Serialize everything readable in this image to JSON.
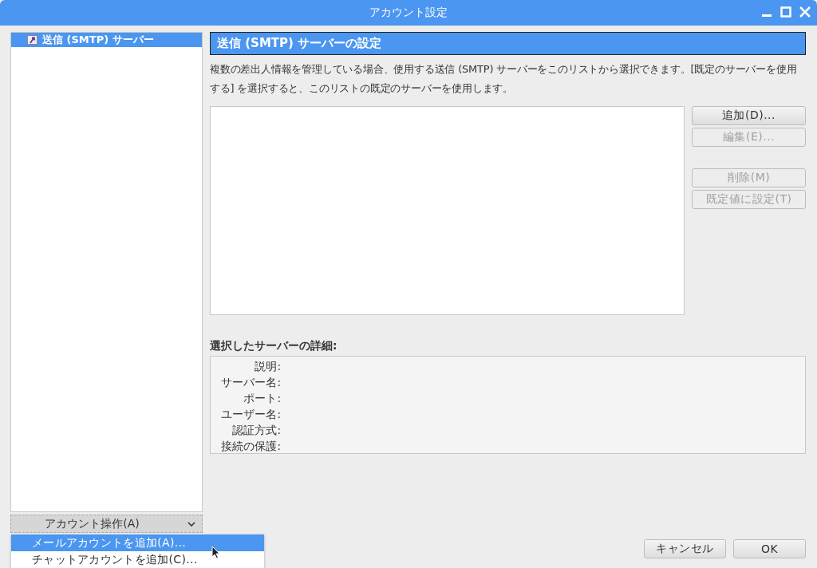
{
  "window": {
    "title": "アカウント設定"
  },
  "sidebar": {
    "items": [
      {
        "label": "送信 (SMTP) サーバー",
        "selected": true
      }
    ]
  },
  "account_actions": {
    "label": "アカウント操作(A)",
    "expanded": true,
    "menu": [
      {
        "label": "メールアカウントを追加(A)...",
        "selected": true
      },
      {
        "label": "チャットアカウントを追加(C)...",
        "selected": false
      }
    ]
  },
  "panel": {
    "heading": "送信 (SMTP) サーバーの設定",
    "description": "複数の差出人情報を管理している場合、使用する送信 (SMTP) サーバーをこのリストから選択できます。[既定のサーバーを使用する] を選択すると、このリストの既定のサーバーを使用します。"
  },
  "server_button_groups": [
    [
      {
        "label": "追加(D)...",
        "disabled": false
      },
      {
        "label": "編集(E)...",
        "disabled": true
      }
    ],
    [
      {
        "label": "削除(M)",
        "disabled": true
      },
      {
        "label": "既定値に設定(T)",
        "disabled": true
      }
    ]
  ],
  "details": {
    "heading": "選択したサーバーの詳細:",
    "fields": [
      "説明:",
      "サーバー名:",
      "ポート:",
      "ユーザー名:",
      "認証方式:",
      "接続の保護:"
    ]
  },
  "buttons": [
    "キャンセル",
    "OK"
  ]
}
